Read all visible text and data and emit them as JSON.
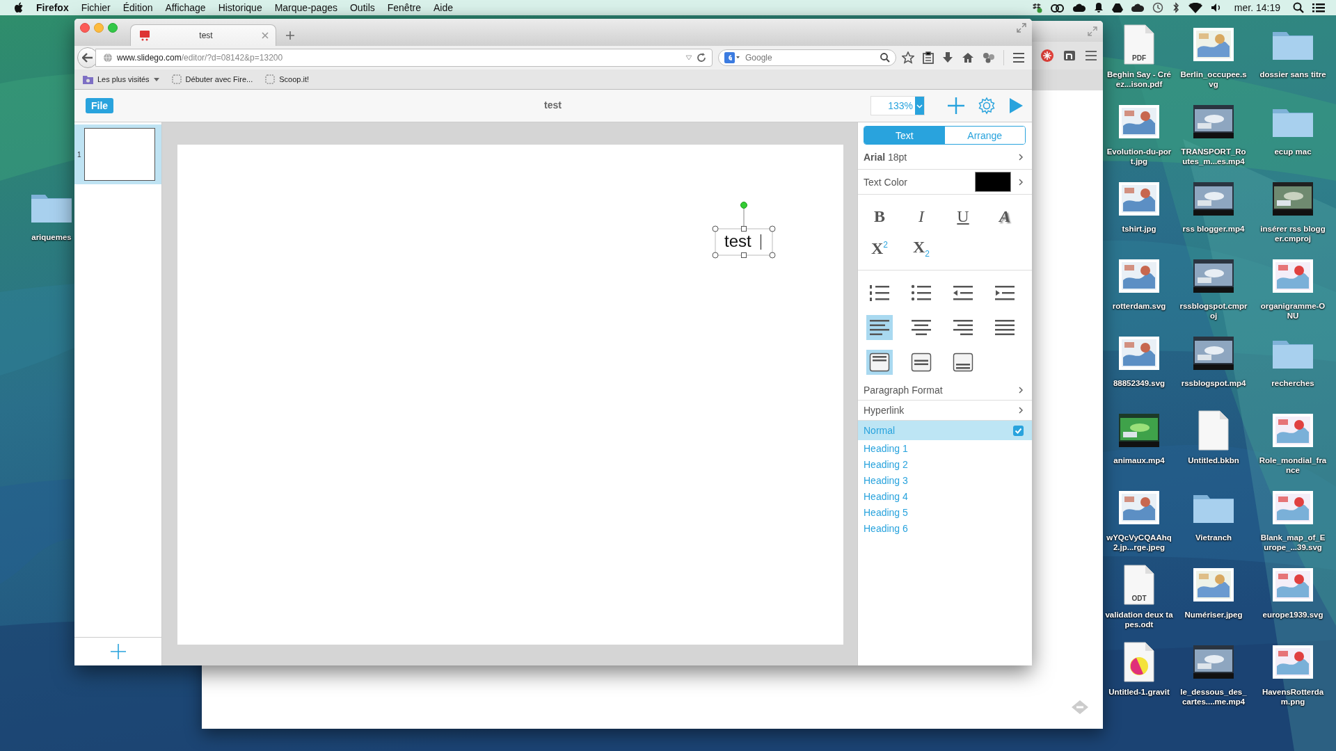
{
  "menubar": {
    "app": "Firefox",
    "menus": [
      "Fichier",
      "Édition",
      "Affichage",
      "Historique",
      "Marque-pages",
      "Outils",
      "Fenêtre",
      "Aide"
    ],
    "clock": "mer. 14:19"
  },
  "browser": {
    "tab_title": "test",
    "url_host": "www.slidego.com",
    "url_path": "/editor/?d=08142&p=13200",
    "search_placeholder": "Google",
    "bookmarks": [
      {
        "label": "Les plus visités",
        "kind": "folder"
      },
      {
        "label": "Débuter avec Fire...",
        "kind": "page"
      },
      {
        "label": "Scoop.it!",
        "kind": "page"
      }
    ]
  },
  "editor": {
    "file_button": "File",
    "title": "test",
    "zoom": "133%",
    "slides": [
      {
        "number": "1",
        "selected": true
      }
    ],
    "text_box": "test"
  },
  "panel": {
    "tabs": [
      {
        "label": "Text",
        "selected": true
      },
      {
        "label": "Arrange",
        "selected": false
      }
    ],
    "font": "**Arial** 18pt",
    "text_color_label": "Text Color",
    "styles": [
      {
        "label": "B",
        "kind": "bold",
        "selected": false
      },
      {
        "label": "I",
        "kind": "italic",
        "selected": false
      },
      {
        "label": "U",
        "kind": "underline",
        "selected": false
      },
      {
        "label": "A",
        "kind": "shadow",
        "selected": false
      },
      {
        "label": "X$^{2}$",
        "kind": "superscript",
        "selected": false
      },
      {
        "label": "X$_{2}$",
        "kind": "subscript",
        "selected": false
      }
    ],
    "lists": [
      {
        "kind": "numbered",
        "selected": false
      },
      {
        "kind": "bulleted",
        "selected": false
      },
      {
        "kind": "outdent",
        "selected": false
      },
      {
        "kind": "indent",
        "selected": false
      }
    ],
    "align": [
      {
        "kind": "left",
        "selected": true
      },
      {
        "kind": "center",
        "selected": false
      },
      {
        "kind": "right",
        "selected": false
      },
      {
        "kind": "justify",
        "selected": false
      }
    ],
    "valign": [
      {
        "kind": "top",
        "selected": true
      },
      {
        "kind": "middle",
        "selected": false
      },
      {
        "kind": "bottom",
        "selected": false
      }
    ],
    "paragraph_format": "Paragraph Format",
    "hyperlink": "Hyperlink",
    "paragraph_styles": [
      {
        "label": "Normal",
        "selected": true
      },
      {
        "label": "Heading 1",
        "selected": false
      },
      {
        "label": "Heading 2",
        "selected": false
      },
      {
        "label": "Heading 3",
        "selected": false
      },
      {
        "label": "Heading 4",
        "selected": false
      },
      {
        "label": "Heading 5",
        "selected": false
      },
      {
        "label": "Heading 6",
        "selected": false
      }
    ]
  },
  "desktop": {
    "left_icons": [
      {
        "label": "ariquemes",
        "kind": "folder"
      }
    ],
    "icons": [
      {
        "label": "Beghin Say - Créez...ison.pdf",
        "kind": "document",
        "badge": "PDF"
      },
      {
        "label": "Berlin_occupee.svg"
      },
      {
        "label": "dossier sans titre",
        "kind": "folder"
      },
      {
        "label": "Evolution-du-port.jpg"
      },
      {
        "label": "TRANSPORT_Routes_m...es.mp4",
        "kind": "video"
      },
      {
        "label": "ecup mac",
        "kind": "folder"
      },
      {
        "label": "tshirt.jpg"
      },
      {
        "label": "rss blogger.mp4",
        "kind": "video"
      },
      {
        "label": "insérer rss blogger.cmproj",
        "kind": "video"
      },
      {
        "label": "rotterdam.svg"
      },
      {
        "label": "rssblogspot.cmproj",
        "kind": "video"
      },
      {
        "label": "organigramme-ONU"
      },
      {
        "label": "88852349.svg"
      },
      {
        "label": "rssblogspot.mp4",
        "kind": "video"
      },
      {
        "label": "recherches",
        "kind": "folder"
      },
      {
        "label": "animaux.mp4",
        "kind": "video"
      },
      {
        "label": "Untitled.bkbn",
        "kind": "document"
      },
      {
        "label": "Role_mondial_france"
      },
      {
        "label": "wYQcVyCQAAhq2.jp...rge.jpeg"
      },
      {
        "label": "Vietranch",
        "kind": "folder"
      },
      {
        "label": "Blank_map_of_Europe_...39.svg"
      },
      {
        "label": "validation deux tapes.odt",
        "kind": "document",
        "badge": "ODT"
      },
      {
        "label": "Numériser.jpeg"
      },
      {
        "label": "europe1939.svg"
      },
      {
        "label": "Untitled-1.gravit",
        "kind": "app-document"
      },
      {
        "label": "le_dessous_des_cartes....me.mp4",
        "kind": "video"
      },
      {
        "label": "HavensRotterdam.png"
      }
    ]
  }
}
